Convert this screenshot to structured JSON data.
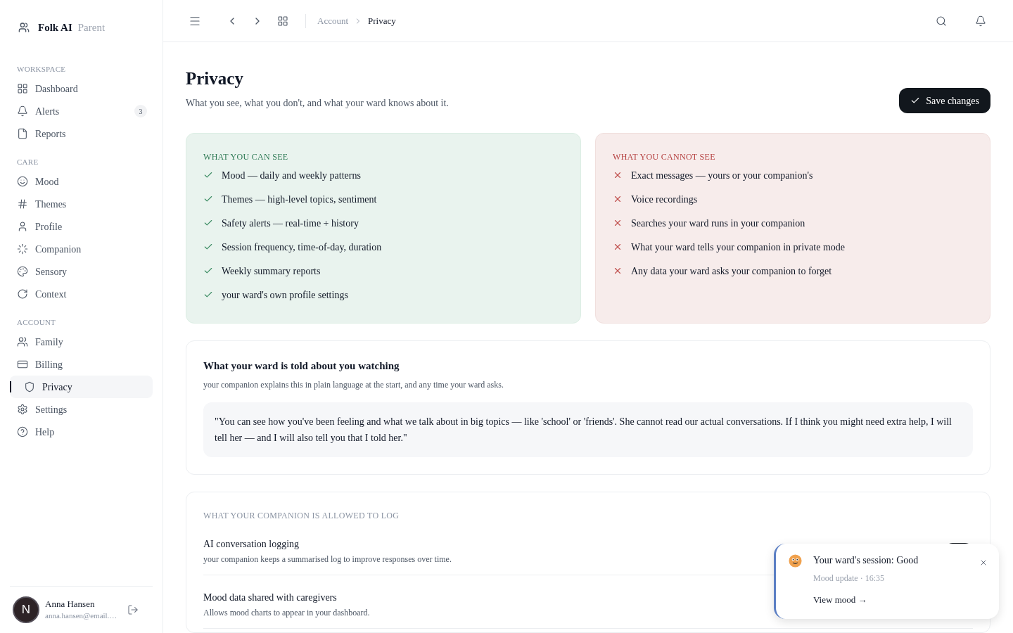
{
  "brand": {
    "name": "Folk AI",
    "role": "Parent"
  },
  "sidebar": {
    "sections": [
      {
        "title": "WORKSPACE",
        "items": [
          {
            "label": "Dashboard",
            "selected": false
          },
          {
            "label": "Alerts",
            "selected": false,
            "badge": "3"
          },
          {
            "label": "Reports",
            "selected": false
          }
        ]
      },
      {
        "title": "CARE",
        "items": [
          {
            "label": "Mood",
            "selected": false
          },
          {
            "label": "Themes",
            "selected": false
          },
          {
            "label": "Profile",
            "selected": false
          },
          {
            "label": "Companion",
            "selected": false
          },
          {
            "label": "Sensory",
            "selected": false
          },
          {
            "label": "Context",
            "selected": false
          }
        ]
      },
      {
        "title": "ACCOUNT",
        "items": [
          {
            "label": "Family",
            "selected": false
          },
          {
            "label": "Billing",
            "selected": false
          },
          {
            "label": "Privacy",
            "selected": true
          },
          {
            "label": "Settings",
            "selected": false
          },
          {
            "label": "Help",
            "selected": false
          }
        ]
      }
    ]
  },
  "user": {
    "initial": "N",
    "name": "Anna Hansen",
    "email": "anna.hansen@email.…"
  },
  "breadcrumb": [
    "Account",
    "Privacy"
  ],
  "page": {
    "title": "Privacy",
    "subtitle": "What you see, what you don't, and what your ward knows about it.",
    "save_button": "Save changes"
  },
  "can_see": {
    "title": "WHAT YOU CAN SEE",
    "items": [
      "Mood — daily and weekly patterns",
      "Themes — high-level topics, sentiment",
      "Safety alerts — real-time + history",
      "Session frequency, time-of-day, duration",
      "Weekly summary reports",
      "your ward's own profile settings"
    ]
  },
  "cannot_see": {
    "title": "WHAT YOU CANNOT SEE",
    "items": [
      "Exact messages — yours or your companion's",
      "Voice recordings",
      "Searches your ward runs in your companion",
      "What your ward tells your companion in private mode",
      "Any data your ward asks your companion to forget"
    ]
  },
  "told": {
    "title": "What your ward is told about you watching",
    "subtitle": "your companion explains this in plain language at the start, and any time your ward asks.",
    "quote": "\"You can see how you've been feeling and what we talk about in big topics — like 'school' or 'friends'. She cannot read our actual conversations. If I think you might need extra help, I will tell her — and I will also tell you that I told her.\""
  },
  "logging": {
    "title": "WHAT YOUR COMPANION IS ALLOWED TO LOG",
    "items": [
      {
        "label": "AI conversation logging",
        "description": "your companion keeps a summarised log to improve responses over time.",
        "on": true
      },
      {
        "label": "Mood data shared with caregivers",
        "description": "Allows mood charts to appear in your dashboard."
      }
    ]
  },
  "toast": {
    "title": "Your ward's session: Good",
    "meta": "Mood update · 16:35",
    "link": "View mood →"
  }
}
